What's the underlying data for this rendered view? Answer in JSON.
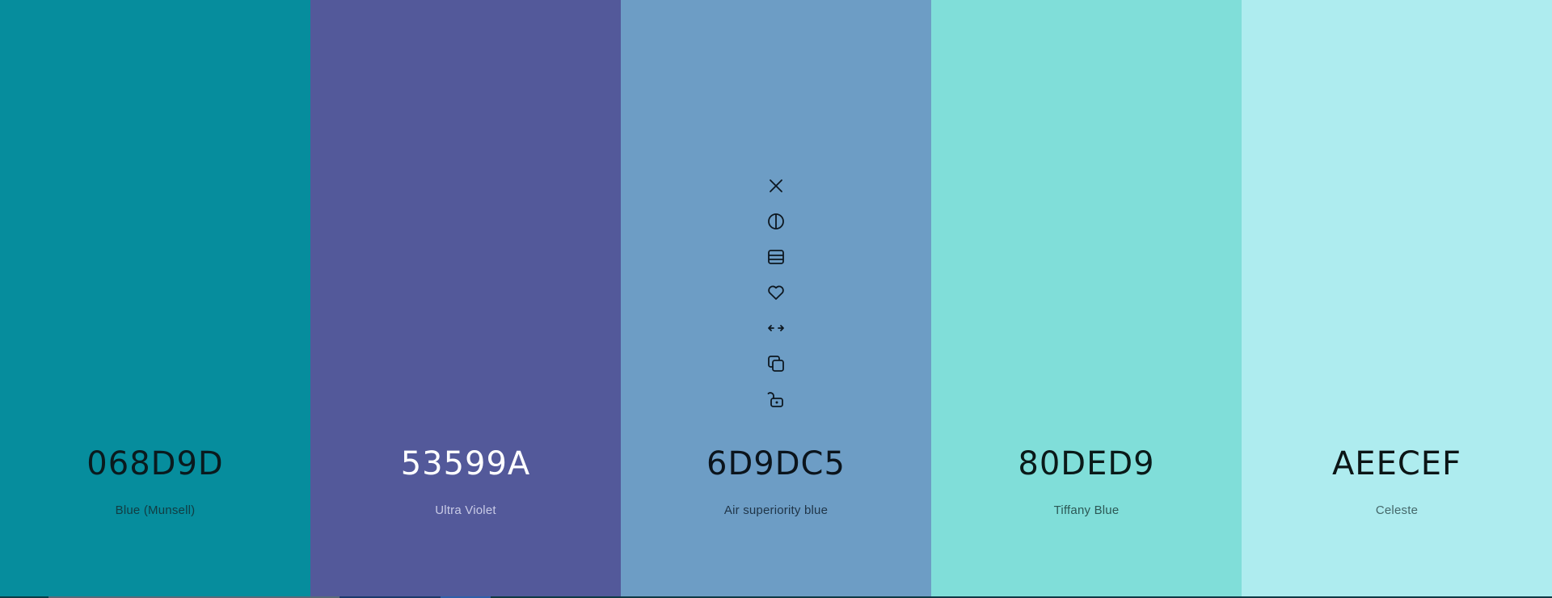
{
  "palette": {
    "swatches": [
      {
        "hex": "068D9D",
        "name": "Blue (Munsell)",
        "bg": "#068D9D",
        "hex_color": "#0a1a1e",
        "name_color": "#123c42"
      },
      {
        "hex": "53599A",
        "name": "Ultra Violet",
        "bg": "#53599A",
        "hex_color": "#ffffff",
        "name_color": "#c9cbe6"
      },
      {
        "hex": "6D9DC5",
        "name": "Air superiority blue",
        "bg": "#6D9DC5",
        "hex_color": "#0b141c",
        "name_color": "#1f3447"
      },
      {
        "hex": "80DED9",
        "name": "Tiffany Blue",
        "bg": "#80DED9",
        "hex_color": "#0a1a19",
        "name_color": "#2c5855"
      },
      {
        "hex": "AEECEF",
        "name": "Celeste",
        "bg": "#AEECEF",
        "hex_color": "#0b1516",
        "name_color": "#45686a"
      }
    ],
    "hovered_swatch_tools": [
      "close-icon",
      "contrast-icon",
      "shades-icon",
      "heart-icon",
      "drag-arrows-icon",
      "copy-icon",
      "unlock-icon"
    ]
  }
}
